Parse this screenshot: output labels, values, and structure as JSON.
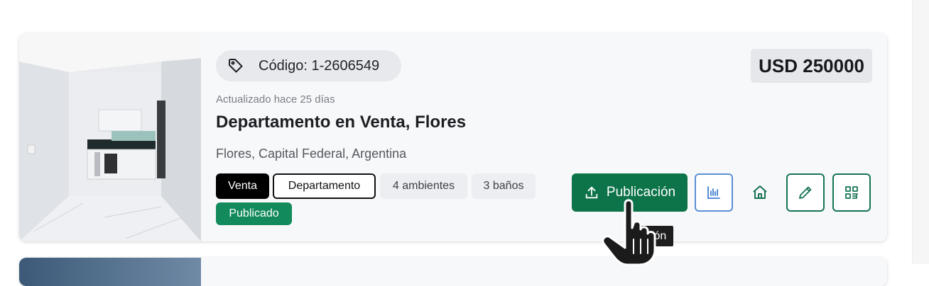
{
  "listing": {
    "code_label": "Código: 1-2606549",
    "price": "USD 250000",
    "updated": "Actualizado hace 25 días",
    "title": "Departamento en Venta, Flores",
    "location": "Flores, Capital Federal, Argentina",
    "tags": {
      "operation": "Venta",
      "property_type": "Departamento",
      "rooms": "4 ambientes",
      "bathrooms": "3 baños",
      "status": "Publicado"
    }
  },
  "actions": {
    "publish_label": "Publicación",
    "tooltip": "ación",
    "icons": [
      "upload-icon",
      "stats-icon",
      "home-icon",
      "edit-icon",
      "qr-icon"
    ]
  },
  "colors": {
    "primary_green": "#0d7349",
    "status_green": "#138a5c",
    "stats_blue": "#5b8fd6"
  }
}
